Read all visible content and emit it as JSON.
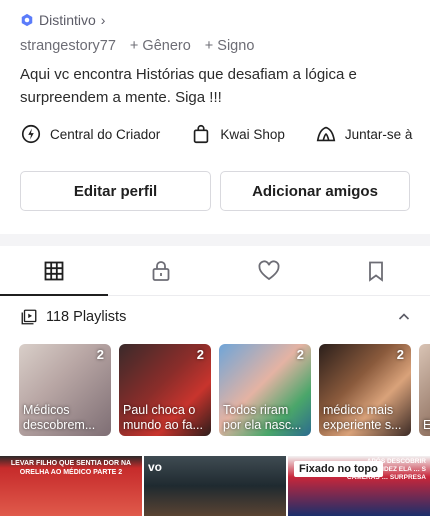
{
  "profile": {
    "badge_label": "Distintivo",
    "badge_chevron": "›",
    "handle": "strangestory77",
    "gender_label": "+ Gênero",
    "sign_label": "+ Signo",
    "bio": "Aqui vc encontra Histórias que desafiam a lógica e surpreendem a mente. Siga !!!"
  },
  "links": [
    {
      "label": "Central do Criador",
      "icon": "lightning-circle-icon"
    },
    {
      "label": "Kwai Shop",
      "icon": "shopping-bag-icon"
    },
    {
      "label": "Juntar-se à",
      "icon": "group-tent-icon"
    }
  ],
  "buttons": {
    "edit": "Editar perfil",
    "add_friends": "Adicionar amigos"
  },
  "tabs": [
    "grid-icon",
    "lock-icon",
    "heart-icon",
    "bookmark-icon"
  ],
  "playlists": {
    "title": "118 Playlists",
    "items": [
      {
        "count": "2",
        "caption": "Médicos descobrem..."
      },
      {
        "count": "2",
        "caption": "Paul choca o mundo ao fa..."
      },
      {
        "count": "2",
        "caption": "Todos riram por ela nasc..."
      },
      {
        "count": "2",
        "caption": "médico mais experiente s..."
      },
      {
        "count": "",
        "caption": "E"
      }
    ]
  },
  "videos": {
    "v1_overlay": "LEVAR FILHO QUE SENTIA DOR NA ORELHA AO MÉDICO PARTE 2",
    "v2_overlay": "vo",
    "pinned_label": "Fixado no topo",
    "v3_overlay": "APÓS DESCOBRIR GRAVIDEZ ELA … S CÂMERAS … SURPRESA"
  },
  "colors": {
    "accent_badge": "#4a6cf7",
    "text_primary": "#1f1f1f",
    "text_secondary": "#6d6d75"
  }
}
